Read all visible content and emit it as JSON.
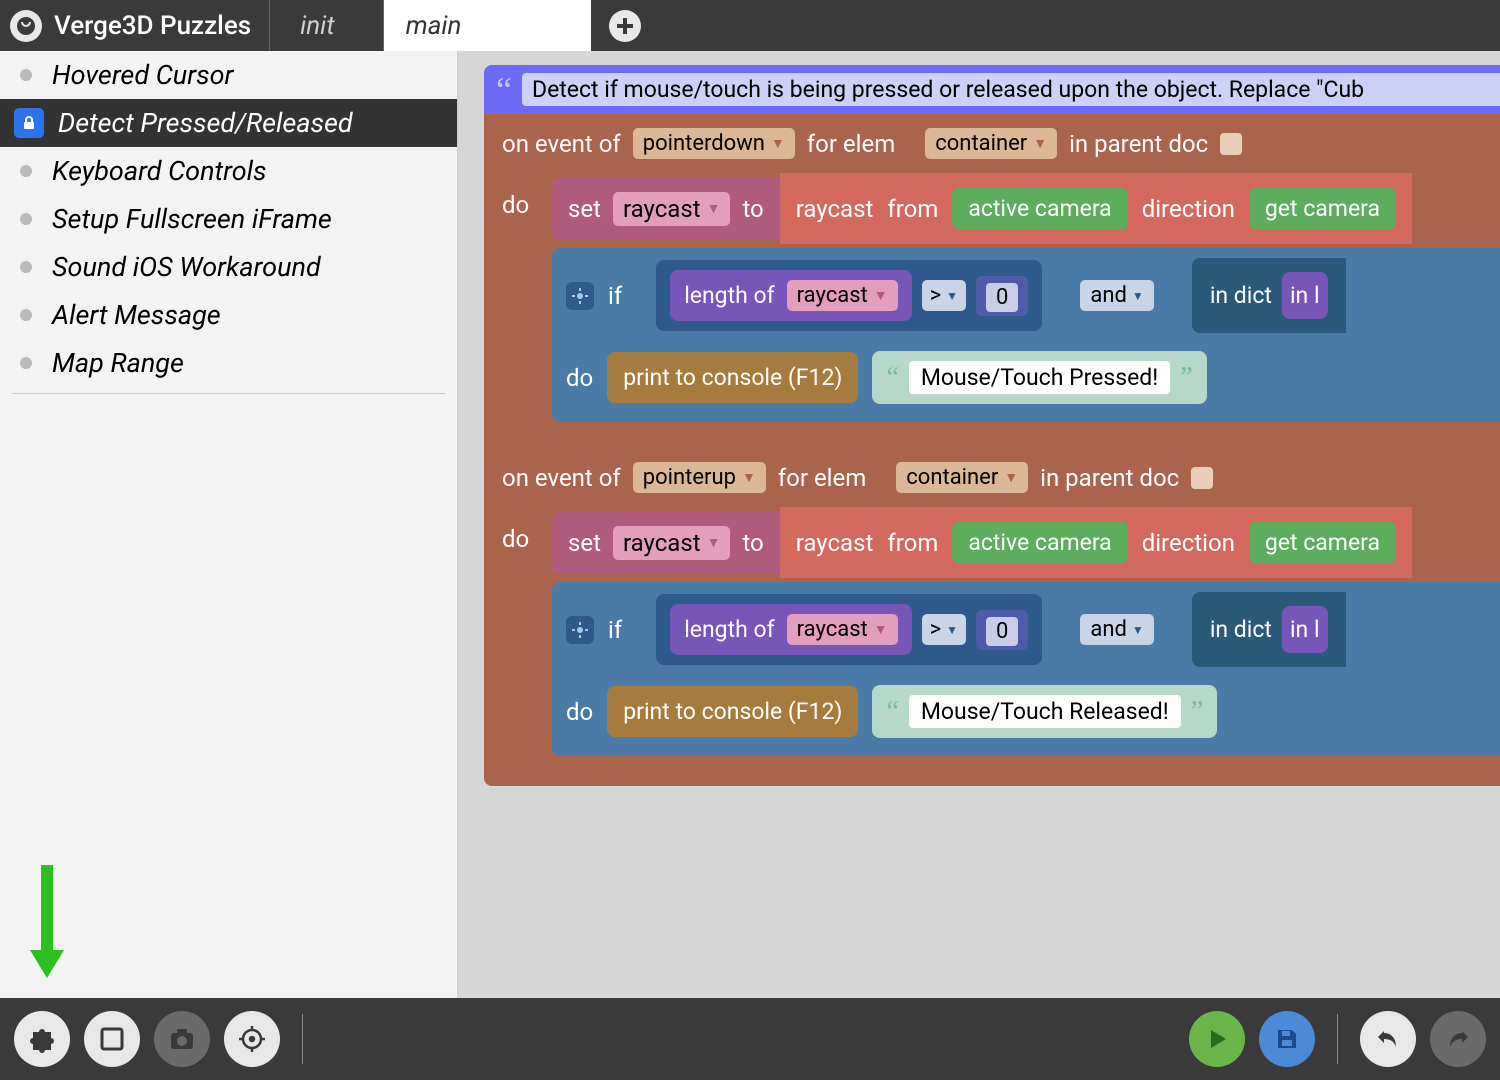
{
  "header": {
    "app_title": "Verge3D Puzzles",
    "tabs": {
      "init": "init",
      "main": "main"
    }
  },
  "sidebar": {
    "items": [
      {
        "label": "Hovered Cursor"
      },
      {
        "label": "Detect Pressed/Released"
      },
      {
        "label": "Keyboard Controls"
      },
      {
        "label": "Setup Fullscreen iFrame"
      },
      {
        "label": "Sound iOS Workaround"
      },
      {
        "label": "Alert Message"
      },
      {
        "label": "Map Range"
      }
    ]
  },
  "canvas": {
    "comment": "Detect if mouse/touch is being pressed or released upon the object. Replace \"Cub",
    "events": [
      {
        "on_event_of": "on event of",
        "event_type": "pointerdown",
        "for_elem": "for elem",
        "elem": "container",
        "in_parent": "in parent doc",
        "do": "do",
        "set": "set",
        "set_var": "raycast",
        "to": "to",
        "raycast_label": "raycast",
        "from": "from",
        "camera": "active camera",
        "direction": "direction",
        "get_camera": "get camera",
        "if": "if",
        "length_of": "length of",
        "len_var": "raycast",
        "op": ">",
        "num": "0",
        "and": "and",
        "in_dict": "in dict",
        "in_l": "in l",
        "inner_do": "do",
        "print": "print to console (F12)",
        "msg": "Mouse/Touch Pressed!"
      },
      {
        "on_event_of": "on event of",
        "event_type": "pointerup",
        "for_elem": "for elem",
        "elem": "container",
        "in_parent": "in parent doc",
        "do": "do",
        "set": "set",
        "set_var": "raycast",
        "to": "to",
        "raycast_label": "raycast",
        "from": "from",
        "camera": "active camera",
        "direction": "direction",
        "get_camera": "get camera",
        "if": "if",
        "length_of": "length of",
        "len_var": "raycast",
        "op": ">",
        "num": "0",
        "and": "and",
        "in_dict": "in dict",
        "in_l": "in l",
        "inner_do": "do",
        "print": "print to console (F12)",
        "msg": "Mouse/Touch Released!"
      }
    ]
  }
}
